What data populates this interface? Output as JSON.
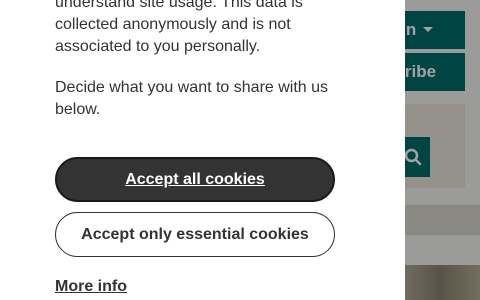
{
  "background": {
    "sign_in_label": "n in",
    "subscribe_label": "scribe",
    "search_label": "s"
  },
  "dialog": {
    "description_1": "understand site usage. This data is collected anonymously and is not associated to you personally.",
    "description_2": "Decide what you want to share with us below.",
    "accept_all_label": "Accept all cookies",
    "accept_essential_label": "Accept only essential cookies",
    "more_info_label": "More info"
  },
  "colors": {
    "brand_teal": "#006b6b",
    "primary_button": "#333333"
  }
}
